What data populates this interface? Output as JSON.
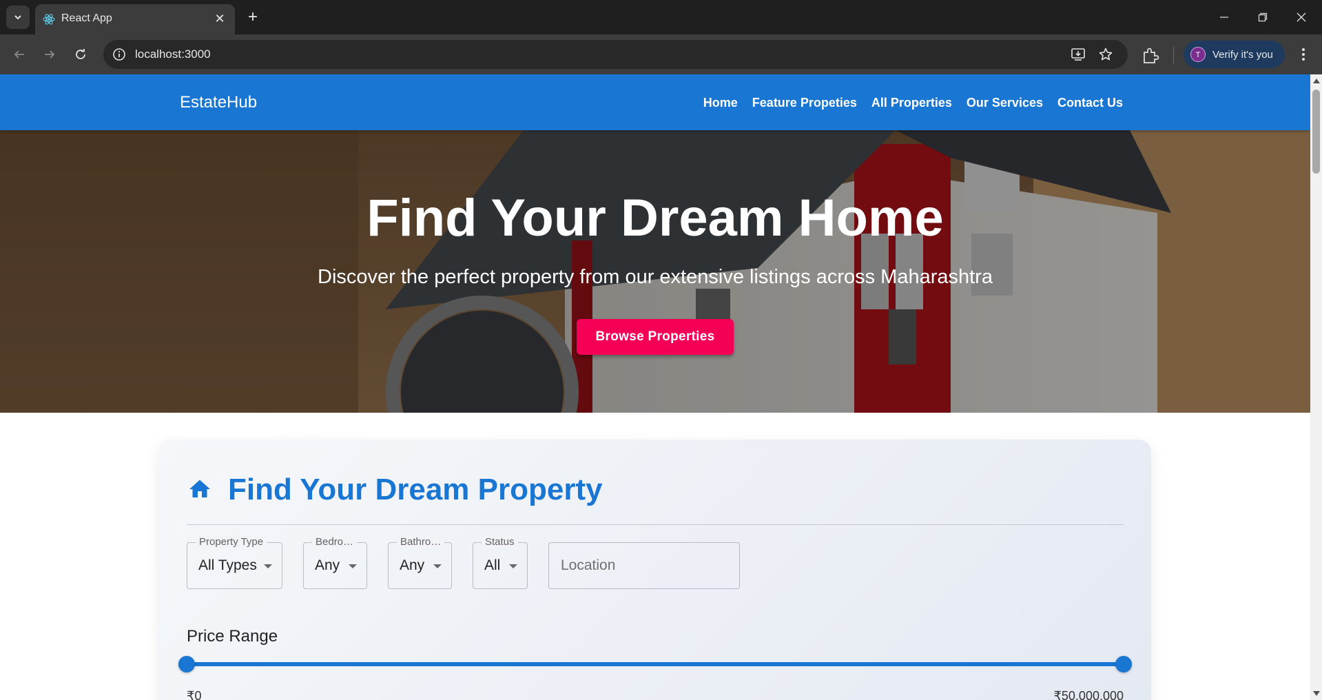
{
  "browser": {
    "tab_title": "React App",
    "url": "localhost:3000",
    "verify_label": "Verify it's you",
    "avatar_initial": "T"
  },
  "app": {
    "brand": "EstateHub",
    "nav": [
      "Home",
      "Feature Propeties",
      "All Properties",
      "Our Services",
      "Contact Us"
    ],
    "accent_color": "#1976d2",
    "cta_color": "#f50057"
  },
  "hero": {
    "title": "Find Your Dream Home",
    "subtitle": "Discover the perfect property from our extensive listings across Maharashtra",
    "button_label": "Browse Properties"
  },
  "search": {
    "title": "Find Your Dream Property",
    "icon": "home-icon",
    "filters": [
      {
        "label": "Property Type",
        "value": "All Types"
      },
      {
        "label": "Bedro…",
        "value": "Any"
      },
      {
        "label": "Bathro…",
        "value": "Any"
      },
      {
        "label": "Status",
        "value": "All"
      }
    ],
    "location_placeholder": "Location",
    "price_label": "Price Range",
    "price_min": "₹0",
    "price_max": "₹50,000,000",
    "price_range_fraction": [
      0,
      1
    ]
  }
}
